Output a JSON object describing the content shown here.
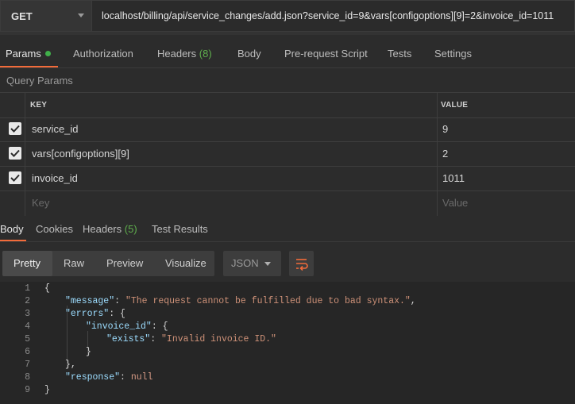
{
  "request": {
    "method": "GET",
    "url": "localhost/billing/api/service_changes/add.json?service_id=9&vars[configoptions][9]=2&invoice_id=1011"
  },
  "request_tabs": [
    {
      "label": "Params",
      "count": ""
    },
    {
      "label": "Authorization",
      "count": ""
    },
    {
      "label": "Headers",
      "count": "(8)"
    },
    {
      "label": "Body",
      "count": ""
    },
    {
      "label": "Pre-request Script",
      "count": ""
    },
    {
      "label": "Tests",
      "count": ""
    },
    {
      "label": "Settings",
      "count": ""
    }
  ],
  "query_params": {
    "title": "Query Params",
    "key_header": "KEY",
    "value_header": "VALUE",
    "rows": [
      {
        "key": "service_id",
        "value": "9",
        "checked": true
      },
      {
        "key": "vars[configoptions][9]",
        "value": "2",
        "checked": true
      },
      {
        "key": "invoice_id",
        "value": "1011",
        "checked": true
      }
    ],
    "key_placeholder": "Key",
    "value_placeholder": "Value"
  },
  "response_tabs": [
    {
      "label": "Body",
      "count": ""
    },
    {
      "label": "Cookies",
      "count": ""
    },
    {
      "label": "Headers",
      "count": "(5)"
    },
    {
      "label": "Test Results",
      "count": ""
    }
  ],
  "view_modes": [
    "Pretty",
    "Raw",
    "Preview",
    "Visualize"
  ],
  "format": "JSON",
  "code": {
    "line_numbers": [
      "1",
      "2",
      "3",
      "4",
      "5",
      "6",
      "7",
      "8",
      "9"
    ],
    "t": {
      "open": "{",
      "message_key": "\"message\"",
      "message_val": "\"The request cannot be fulfilled due to bad syntax.\"",
      "errors_key": "\"errors\"",
      "invoice_key": "\"invoice_id\"",
      "exists_key": "\"exists\"",
      "exists_val": "\"Invalid invoice ID.\"",
      "close_inner": "}",
      "close_errors": "},",
      "response_key": "\"response\"",
      "response_val": "null",
      "close": "}"
    }
  },
  "colors": {
    "accent": "#f26b3a",
    "count_green": "#5fae4d",
    "status_dot": "#40b04a"
  }
}
